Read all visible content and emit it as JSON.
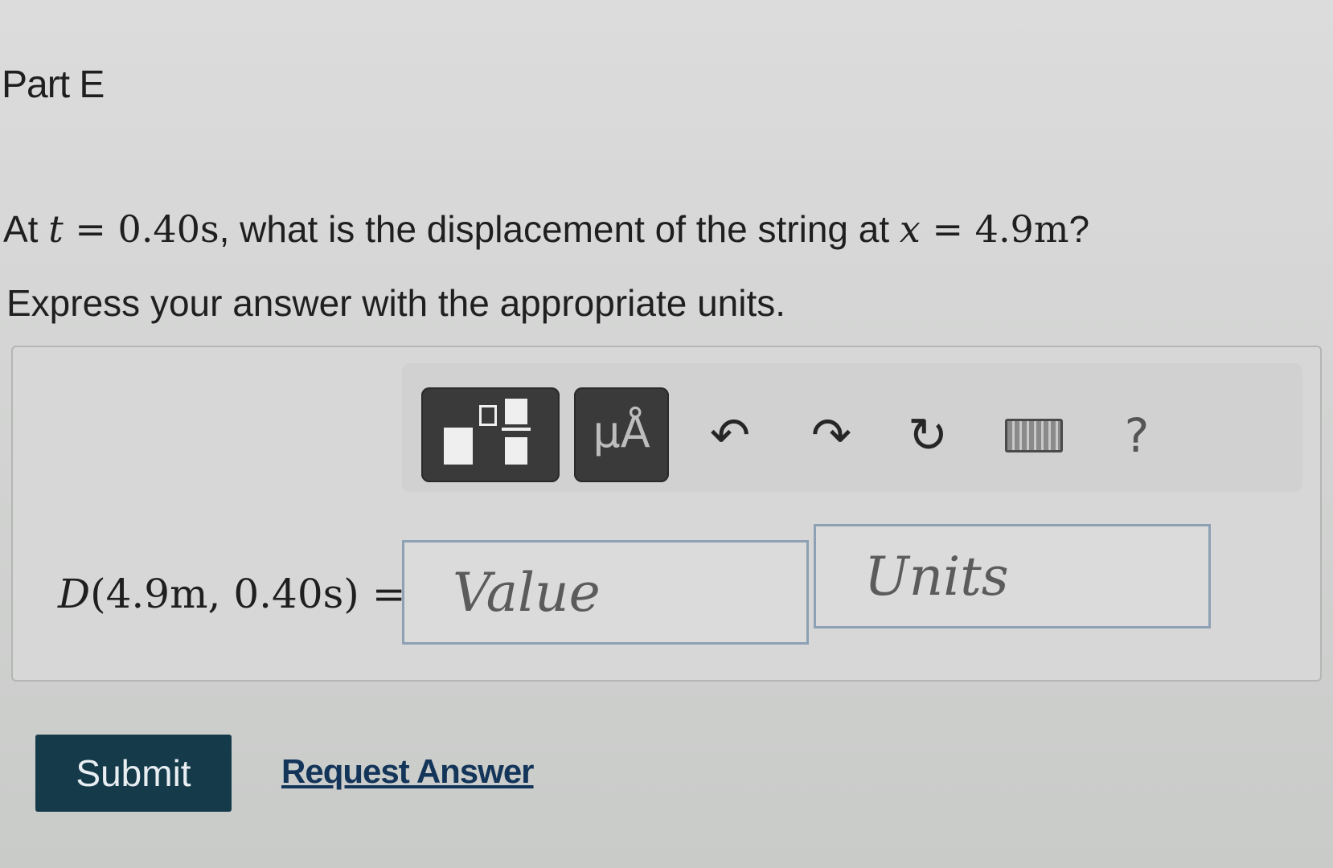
{
  "part": {
    "title": "Part E"
  },
  "question": {
    "prefix": "At",
    "t_var": "t",
    "eq1": "=",
    "t_value": "0.40s",
    "middle": ", what is the displacement of the string at",
    "x_var": "x",
    "eq2": "=",
    "x_value": "4.9m",
    "suffix": "?"
  },
  "instruction": "Express your answer with the appropriate units.",
  "toolbar": {
    "units_button_label": "μÅ",
    "help_label": "?",
    "icons": [
      "templates-icon",
      "units-icon",
      "undo-icon",
      "redo-icon",
      "reset-icon",
      "keyboard-icon",
      "help-icon"
    ]
  },
  "answer": {
    "label_func": "D",
    "label_args": "(4.9m, 0.40s)",
    "label_eq": "=",
    "value_placeholder": "Value",
    "units_placeholder": "Units"
  },
  "actions": {
    "submit_label": "Submit",
    "request_answer_label": "Request Answer"
  },
  "colors": {
    "submit_bg": "#153a4a",
    "link": "#14355a",
    "field_border": "#8da0b4"
  }
}
